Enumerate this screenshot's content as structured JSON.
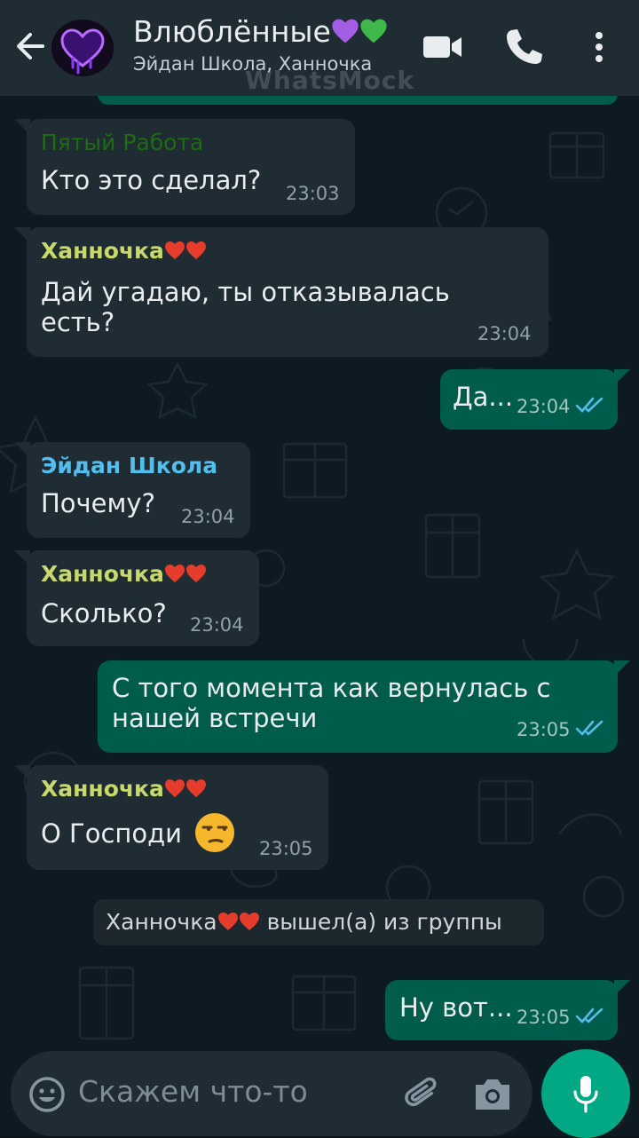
{
  "header": {
    "title": "Влюблённые",
    "subtitle": "Эйдан Школа, Ханночка",
    "watermark": "WhatsMock"
  },
  "messages": [
    {
      "sender": "Пятый Работа",
      "sender_color": "#1e6b14",
      "text": "Кто это сделал?",
      "time": "23:03"
    },
    {
      "sender": "Ханночка",
      "sender_color": "#c8d96b",
      "text": "Дай угадаю, ты отказывалась есть?",
      "time": "23:04"
    },
    {
      "text": "Да...",
      "time": "23:04",
      "status": "read"
    },
    {
      "sender": "Эйдан Школа",
      "sender_color": "#53bdeb",
      "text": "Почему?",
      "time": "23:04"
    },
    {
      "sender": "Ханночка",
      "sender_color": "#c8d96b",
      "text": "Сколько?",
      "time": "23:04"
    },
    {
      "text": "С того момента как вернулась с нашей встречи",
      "time": "23:05",
      "status": "read"
    },
    {
      "sender": "Ханночка",
      "sender_color": "#c8d96b",
      "text": "О Господи",
      "emoji": "unamused-face",
      "time": "23:05"
    },
    {
      "text": "Ну вот...",
      "time": "23:05",
      "status": "read"
    }
  ],
  "system_notice": {
    "name": "Ханночка",
    "action": "вышел(а) из группы"
  },
  "input": {
    "placeholder": "Скажем что-то"
  },
  "colors": {
    "outgoing": "#005c4b",
    "incoming": "#202c33",
    "accent": "#00a884",
    "read_ticks": "#53bdeb",
    "header": "#1f2c34"
  }
}
